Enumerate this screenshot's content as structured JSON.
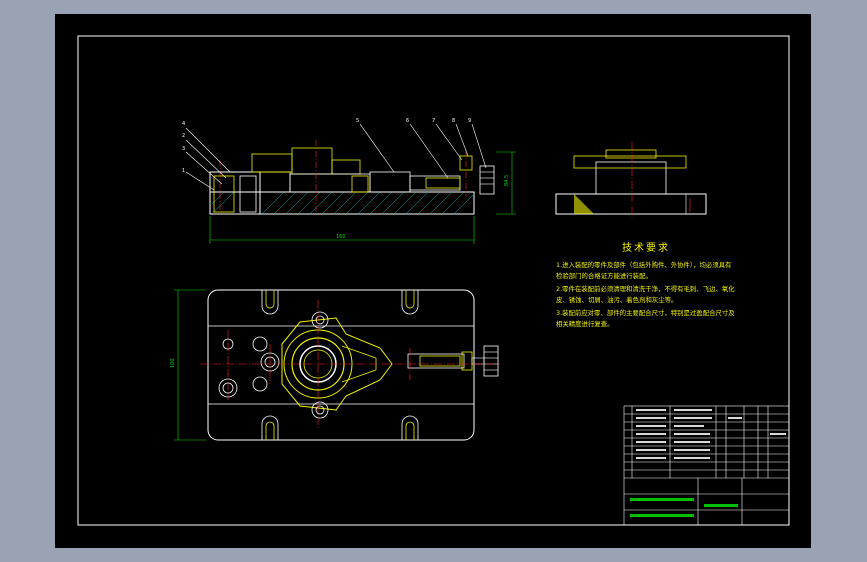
{
  "drawing": {
    "tech_requirements": {
      "title": "技术要求",
      "lines": [
        "1.进入装配的零件及部件（包括外购件、外协件），均必须具有",
        "检验部门的合格证方能进行装配。",
        "2.零件在装配前必须清理和清洗干净，不得有毛刺、飞边、氧化",
        "皮、锈蚀、切屑、油污、着色剂和灰尘等。",
        "3.装配前应对零、部件的主要配合尺寸，特别是过盈配合尺寸及",
        "相关精度进行复查。"
      ]
    },
    "balloons": [
      "4",
      "2",
      "3",
      "1",
      "5",
      "6",
      "7",
      "8",
      "9"
    ],
    "dims": {
      "length": "160",
      "height": "84.5",
      "width": "100"
    },
    "colors": {
      "background": "#9aa3b4",
      "sheet": "#000000",
      "outline": "#ffffff",
      "yellow": "#f2f200",
      "green": "#00e000",
      "red": "#ff2020",
      "cyan": "#00e0e0"
    }
  }
}
